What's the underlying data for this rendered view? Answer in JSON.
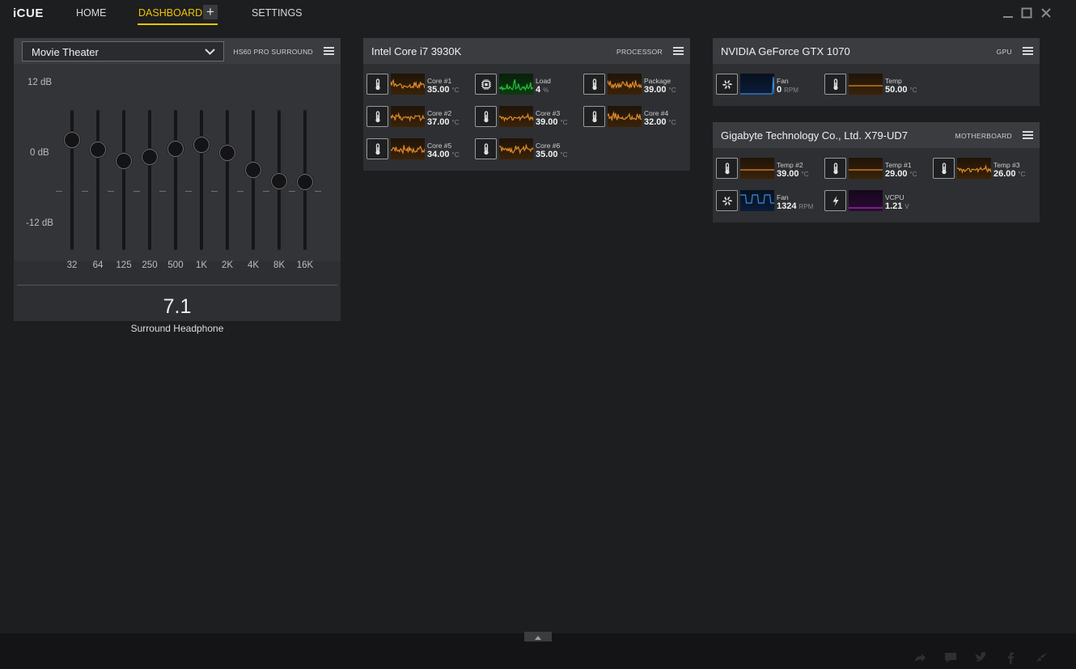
{
  "app": {
    "logo": "iCUE"
  },
  "nav": {
    "home": "HOME",
    "dashboard": "DASHBOARD",
    "settings": "SETTINGS",
    "add": "+"
  },
  "colors": {
    "accent": "#f0c400",
    "temp_line": "#e08a2c",
    "load_line": "#22c43a",
    "fan_line": "#3a8ee0",
    "voltage_line": "#b02fc0"
  },
  "eq": {
    "preset": "Movie Theater",
    "device_tag": "HS60 PRO SURROUND",
    "db_labels": {
      "top": "12 dB",
      "mid": "0 dB",
      "bottom": "-12 dB"
    },
    "bands": [
      {
        "freq": "32",
        "gain_db": 5.5
      },
      {
        "freq": "64",
        "gain_db": 3.8
      },
      {
        "freq": "125",
        "gain_db": 1.9
      },
      {
        "freq": "250",
        "gain_db": 2.6
      },
      {
        "freq": "500",
        "gain_db": 3.9
      },
      {
        "freq": "1K",
        "gain_db": 4.7
      },
      {
        "freq": "2K",
        "gain_db": 3.3
      },
      {
        "freq": "4K",
        "gain_db": 0.4
      },
      {
        "freq": "8K",
        "gain_db": -1.6
      },
      {
        "freq": "16K",
        "gain_db": -1.8
      }
    ],
    "mode_value": "7.1",
    "mode_label": "Surround Headphone"
  },
  "processor": {
    "title": "Intel Core i7 3930K",
    "tag": "PROCESSOR",
    "sensors": [
      {
        "icon": "thermometer-icon",
        "name": "Core #1",
        "value": "35.00",
        "unit": "°C",
        "graph": "temp"
      },
      {
        "icon": "cpu-chip-icon",
        "name": "Load",
        "value": "4",
        "unit": "%",
        "graph": "load"
      },
      {
        "icon": "thermometer-icon",
        "name": "Package",
        "value": "39.00",
        "unit": "°C",
        "graph": "temp"
      },
      {
        "icon": "thermometer-icon",
        "name": "Core #2",
        "value": "37.00",
        "unit": "°C",
        "graph": "temp"
      },
      {
        "icon": "thermometer-icon",
        "name": "Core #3",
        "value": "39.00",
        "unit": "°C",
        "graph": "temp"
      },
      {
        "icon": "thermometer-icon",
        "name": "Core #4",
        "value": "32.00",
        "unit": "°C",
        "graph": "temp"
      },
      {
        "icon": "thermometer-icon",
        "name": "Core #5",
        "value": "34.00",
        "unit": "°C",
        "graph": "temp"
      },
      {
        "icon": "thermometer-icon",
        "name": "Core #6",
        "value": "35.00",
        "unit": "°C",
        "graph": "temp"
      }
    ]
  },
  "gpu": {
    "title": "NVIDIA GeForce GTX 1070",
    "tag": "GPU",
    "sensors": [
      {
        "icon": "fan-icon",
        "name": "Fan",
        "value": "0",
        "unit": "RPM",
        "graph": "fan_flat"
      },
      {
        "icon": "thermometer-icon",
        "name": "Temp",
        "value": "50.00",
        "unit": "°C",
        "graph": "temp_flat"
      }
    ]
  },
  "motherboard": {
    "title": "Gigabyte Technology Co., Ltd. X79-UD7",
    "tag": "MOTHERBOARD",
    "sensors": [
      {
        "icon": "thermometer-icon",
        "name": "Temp #2",
        "value": "39.00",
        "unit": "°C",
        "graph": "temp_flat"
      },
      {
        "icon": "thermometer-icon",
        "name": "Temp #1",
        "value": "29.00",
        "unit": "°C",
        "graph": "temp_flat"
      },
      {
        "icon": "thermometer-icon",
        "name": "Temp #3",
        "value": "26.00",
        "unit": "°C",
        "graph": "temp"
      },
      {
        "icon": "fan-icon",
        "name": "Fan",
        "value": "1324",
        "unit": "RPM",
        "graph": "fan"
      },
      {
        "icon": "lightning-icon",
        "name": "VCPU",
        "value": "1.21",
        "unit": "V",
        "graph": "voltage"
      }
    ]
  },
  "footer": {
    "icons": [
      "share-icon",
      "chat-icon",
      "twitter-icon",
      "facebook-icon",
      "corsair-logo-icon"
    ]
  }
}
